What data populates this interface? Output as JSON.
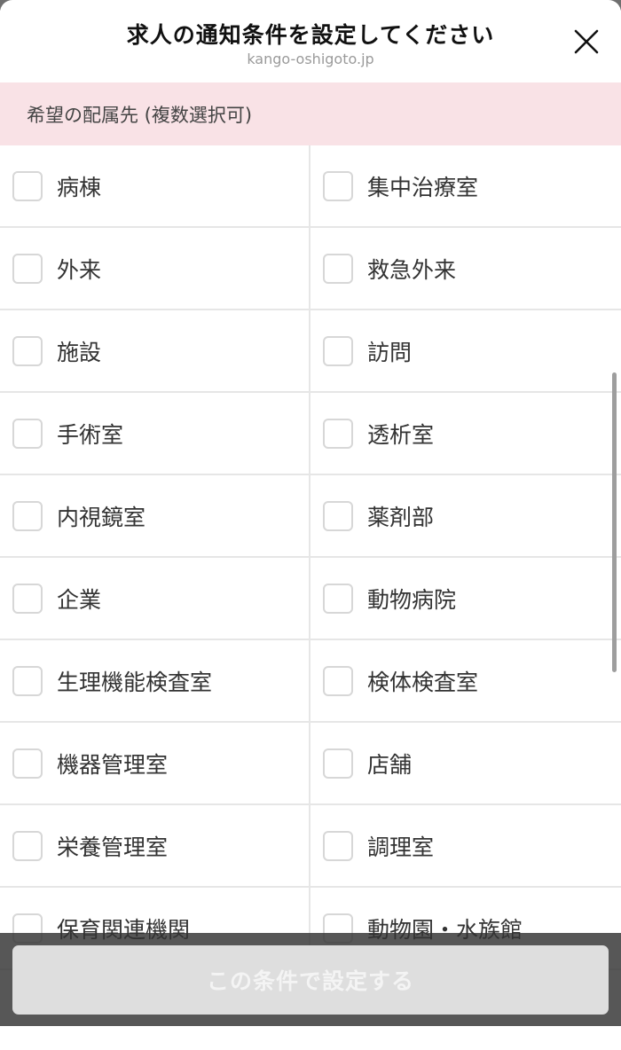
{
  "header": {
    "title": "求人の通知条件を設定してください",
    "url": "kango-oshigoto.jp",
    "close_icon": "close-icon"
  },
  "section": {
    "label": "希望の配属先 (複数選択可)"
  },
  "options": {
    "left": [
      {
        "label": "病棟",
        "checked": false
      },
      {
        "label": "外来",
        "checked": false
      },
      {
        "label": "施設",
        "checked": false
      },
      {
        "label": "手術室",
        "checked": false
      },
      {
        "label": "内視鏡室",
        "checked": false
      },
      {
        "label": "企業",
        "checked": false
      },
      {
        "label": "生理機能検査室",
        "checked": false
      },
      {
        "label": "機器管理室",
        "checked": false
      },
      {
        "label": "栄養管理室",
        "checked": false
      },
      {
        "label": "保育関連機関",
        "checked": false
      }
    ],
    "right": [
      {
        "label": "集中治療室",
        "checked": false
      },
      {
        "label": "救急外来",
        "checked": false
      },
      {
        "label": "訪問",
        "checked": false
      },
      {
        "label": "透析室",
        "checked": false
      },
      {
        "label": "薬剤部",
        "checked": false
      },
      {
        "label": "動物病院",
        "checked": false
      },
      {
        "label": "検体検査室",
        "checked": false
      },
      {
        "label": "店舗",
        "checked": false
      },
      {
        "label": "調理室",
        "checked": false
      },
      {
        "label": "動物園・水族館",
        "checked": false
      }
    ]
  },
  "footer": {
    "submit_label": "この条件で設定する"
  },
  "colors": {
    "section_bg": "#f9e2e6",
    "button_disabled_bg": "#dedede",
    "divider": "#e6e6e6"
  }
}
